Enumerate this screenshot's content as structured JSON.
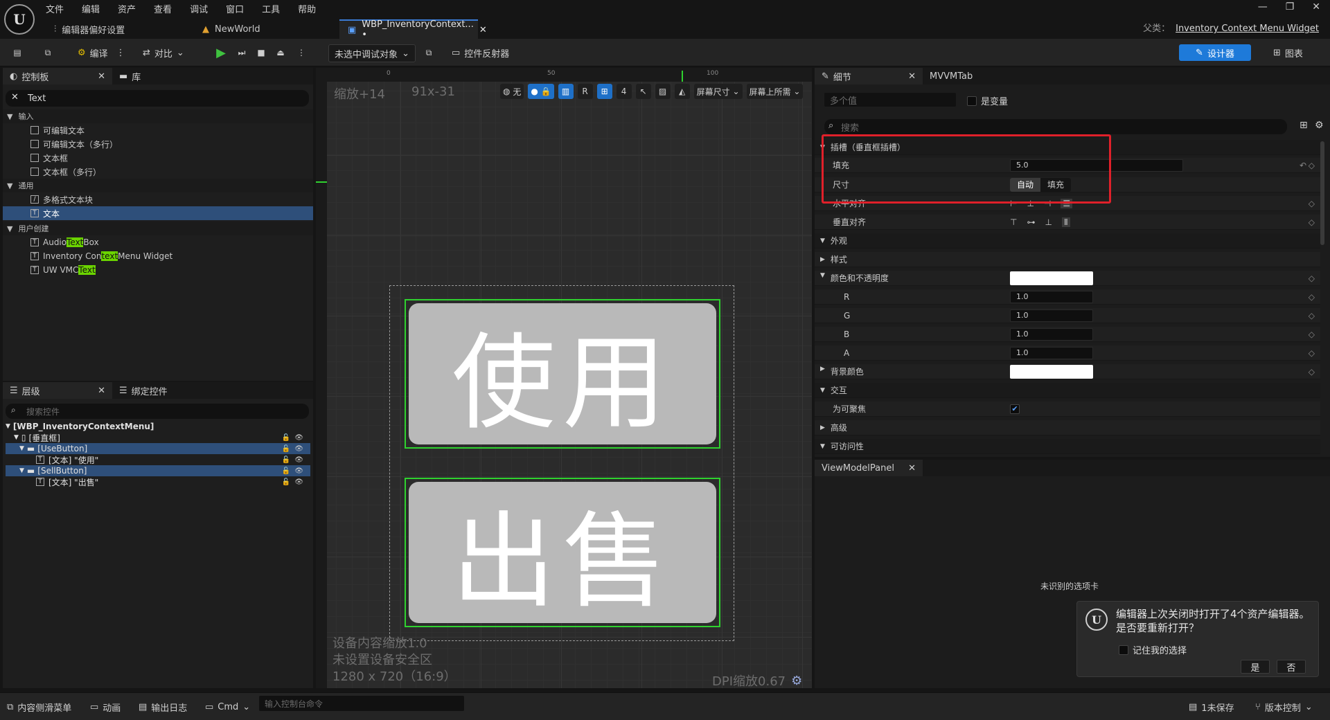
{
  "menu": [
    "文件",
    "编辑",
    "资产",
    "查看",
    "调试",
    "窗口",
    "工具",
    "帮助"
  ],
  "tabs": {
    "prefs": "编辑器偏好设置",
    "world": "NewWorld",
    "wbp": "WBP_InventoryContext... •"
  },
  "parent_class": {
    "label": "父类：",
    "value": "Inventory Context Menu Widget"
  },
  "toolbar": {
    "compile": "编译",
    "diff": "对比",
    "debug_target": "未选中调试对象",
    "reflector": "控件反射器",
    "designer": "设计器",
    "graph": "图表"
  },
  "palette": {
    "tab_palette": "控制板",
    "tab_library": "库",
    "search_value": "Text",
    "cat_input": "输入",
    "items_input": [
      "可编辑文本",
      "可编辑文本（多行）",
      "文本框",
      "文本框（多行）"
    ],
    "cat_common": "通用",
    "items_common": [
      "多格式文本块",
      "文本"
    ],
    "cat_user": "用户创建",
    "user_items": [
      {
        "pre": "Audio ",
        "hl": "Text",
        "post": " Box"
      },
      {
        "pre": "Inventory Con",
        "hl": "text",
        "post": "Menu Widget"
      },
      {
        "pre": "UW VMC",
        "hl": "Text",
        "post": ""
      }
    ]
  },
  "hierarchy": {
    "tab_hierarchy": "层级",
    "tab_bind": "绑定控件",
    "search_placeholder": "搜索控件",
    "root": "[WBP_InventoryContextMenu]",
    "vbox": "[垂直框]",
    "use_button": "[UseButton]",
    "use_text": "[文本] \"使用\"",
    "sell_button": "[SellButton]",
    "sell_text": "[文本] \"出售\""
  },
  "viewport": {
    "zoom": "缩放+14",
    "coord": "91x-31",
    "tool_none": "无",
    "tool_r": "R",
    "tool_grid": "4",
    "screen_size": "屏幕尺寸",
    "screen_fill": "屏幕上所需",
    "ruler_marks": [
      "0",
      "50",
      "100"
    ],
    "btn_use": "使用",
    "btn_sell": "出售",
    "info1": "设备内容缩放1.0",
    "info2": "未设置设备安全区",
    "info3": "1280 x 720（16:9）",
    "dpi": "DPI缩放0.67"
  },
  "details": {
    "tab_details": "细节",
    "tab_mvvm": "MVVMTab",
    "name_placeholder": "多个值",
    "is_variable": "是变量",
    "search_placeholder": "搜索",
    "slot_section": "插槽（垂直框插槽）",
    "padding_label": "填充",
    "padding_value": "5.0",
    "size_label": "尺寸",
    "size_auto": "自动",
    "size_fill": "填充",
    "halign_label": "水平对齐",
    "valign_label": "垂直对齐",
    "appearance": "外观",
    "style": "样式",
    "color_opacity": "颜色和不透明度",
    "r_label": "R",
    "r_value": "1.0",
    "g_label": "G",
    "g_value": "1.0",
    "b_label": "B",
    "b_value": "1.0",
    "a_label": "A",
    "a_value": "1.0",
    "bg_color": "背景颜色",
    "interaction": "交互",
    "focusable": "为可聚焦",
    "advanced": "高级",
    "accessibility": "可访问性"
  },
  "viewmodel": {
    "tab": "ViewModelPanel",
    "unrecognized": "未识别的选项卡"
  },
  "toast": {
    "message": "编辑器上次关闭时打开了4个资产编辑器。是否要重新打开？",
    "remember": "记住我的选择",
    "yes": "是",
    "no": "否"
  },
  "statusbar": {
    "content_drawer": "内容侧滑菜单",
    "animation": "动画",
    "output_log": "输出日志",
    "cmd": "Cmd",
    "console_placeholder": "输入控制台命令",
    "unsaved": "1未保存",
    "source_control": "版本控制"
  }
}
